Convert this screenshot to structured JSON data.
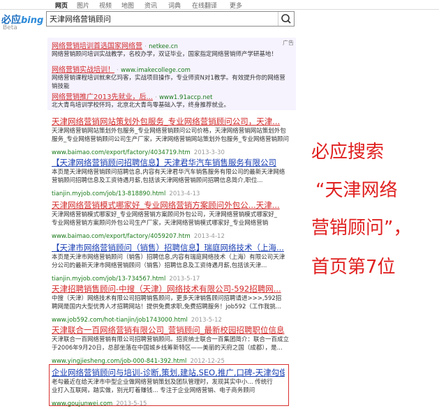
{
  "nav": [
    "网页",
    "图片",
    "视频",
    "地图",
    "资讯",
    "词典",
    "在线翻译",
    "更多"
  ],
  "logo": {
    "main": "必应",
    "bing": "bing",
    "beta": "Beta"
  },
  "search": {
    "value": "天津网络营销顾问"
  },
  "ads": {
    "label": "广告",
    "items": [
      {
        "title": "网络营销培训首选国家网络营",
        "url": "netkee.cn",
        "desc1": "网络营销顾问培训实战教学，名校办学，双证毕业，国家指定网络营销师产学研基地！"
      },
      {
        "title": "网络营销实战培训！",
        "url": "www.imakecollege.com",
        "desc1": "网络营销课程培训就来亿玛客，实战项目操作，专业师资N对1教学。有效提升你的网络营",
        "desc2": "销技能"
      },
      {
        "title": "网络营销推广2013先就业，后...",
        "url": "www1.91accp.net",
        "desc1": "北大青鸟培训学校怀玛，北京北大青鸟零基础入学，终身推荐就业。"
      }
    ]
  },
  "results": [
    {
      "title": "天津网络营销网站策划外包服务_专业网络营销顾问公司，天津...",
      "desc1": "天津网络营销网站策划外包服务_专业网络营销顾问公司价格，天津网络营销网站策划外包",
      "desc2": "服务_专业网络营销顾问公司生产厂家，天津网络营销网站策划外包服务_专业网络营销顾问",
      "url": "www.baimao.com/export/factory/4034719.htm",
      "date": "2013-3-30"
    },
    {
      "title": "【天津网络营销顾问招聘信息】天津君华汽车销售服务有限公司",
      "desc1": "本页是天津网络营销顾问招聘信息,内容有天津君华汽车销售服务有限公司的最新天津网络",
      "desc2": "营销顾问招聘信息及工资待遇月薪,包括该天津网络营销顾问招聘信息简介,职位...",
      "url": "tianjin.myjob.com/job/13-818890.html",
      "date": "2013-4-13"
    },
    {
      "title": "天津网络营销模式哪家好_专业网络营销方案顾问外包公...天津...",
      "desc1": "天津网络营销模式哪家好_专业网络营销方案顾问外包公司，天津网络营销模式哪家好_",
      "desc2": "专业网络营销方案顾问外包公司生产厂家，天津网络营销模式哪家好_专业网络营销",
      "url": "www.baimao.com/export/factory/4059207.htm",
      "date": "2013-4-12"
    },
    {
      "title": "【天津市网络营销顾问（销售）招聘信息】瑞庭网络技术（上海...",
      "desc1": "本页是天津市网络营销顾问（销售）招聘信息,内容有瑞庭网络技术（上海）有限公司天津",
      "desc2": "分公司的最新天津市网络营销顾问（销售）招聘信息及工资待遇月薪,包括该天津...",
      "url": "tianjin.myjob.com/job/13-734567.html",
      "date": "2013-5-17"
    },
    {
      "title": "天津招聘销售顾问-中搜（天津）网络技术有限公司-592招聘网...",
      "desc1": "中搜（天津）网络技术有限公司招聘销售顾问，更多天津销售顾问招聘请进>>>,592招",
      "desc2": "聘网是国内大型优秀人才招聘网站！提供免费求职,免费招聘服务！job592（工作我挑...",
      "url": "www.job592.com/hot-tianjin/job1743000.html",
      "date": "2013-5-12"
    },
    {
      "title": "天津联合一百网络营销有限公司_营销顾问_最新校园招聘职位信息",
      "desc1": "天津联合一百网络营销有限公司招聘营销顾问。招资纳士联合一百集团简介：联合一百成立",
      "desc2": "于2006年9月20日，总部坐落在中国城乡线筹新特区——美丽的天府之国（成都），是...",
      "url": "www.yingjiesheng.com/job-000-841-392.html",
      "date": "2012-12-25"
    },
    {
      "title": "企业网络营销顾问与培训-诊断,策划,建站,SEO,推广,口碑-天津勾俊伟",
      "desc1": "老勾最近在给天津市中型企业做网络营销策划及团队管理时，发现其实中小... 传统行",
      "desc2": "业打入互联网，踏实做，别光盯着赚钱... 专注于企业网络营销、电子商务顾问",
      "url": "www.goujunwei.com",
      "date": "2013-5-15"
    }
  ],
  "annotation": {
    "line1": "必应搜索",
    "line2": "“天津网络",
    "line3": "营销顾问”，",
    "line4": "首页第7位"
  },
  "colors": {
    "title": "#1a3fb3",
    "url": "#1a7a1a",
    "highlight": "#d32b2b",
    "annotation": "#e02020"
  },
  "icons": {
    "search": "search-icon"
  }
}
